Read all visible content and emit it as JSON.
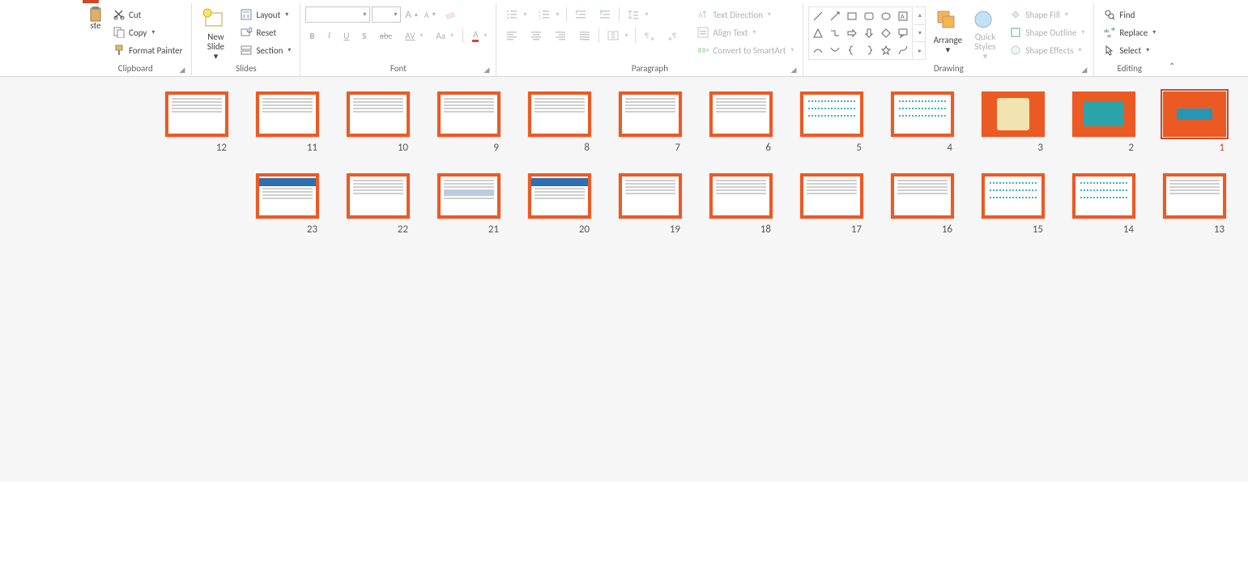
{
  "ribbon": {
    "clipboard": {
      "label": "Clipboard",
      "paste": "ste",
      "cut": "Cut",
      "copy": "Copy",
      "format_painter": "Format Painter"
    },
    "slides": {
      "label": "Slides",
      "new_slide": "New\nSlide",
      "layout": "Layout",
      "reset": "Reset",
      "section": "Section"
    },
    "font": {
      "label": "Font",
      "name_placeholder": "",
      "size_placeholder": "",
      "bold": "B",
      "italic": "I",
      "underline": "U",
      "shadow": "S",
      "strike": "abc",
      "spacing": "AV",
      "case": "Aa",
      "color": "A"
    },
    "paragraph": {
      "label": "Paragraph",
      "text_direction": "Text Direction",
      "align_text": "Align Text",
      "smartart": "Convert to SmartArt"
    },
    "drawing": {
      "label": "Drawing",
      "arrange": "Arrange",
      "quick_styles": "Quick\nStyles",
      "shape_fill": "Shape Fill",
      "shape_outline": "Shape Outline",
      "shape_effects": "Shape Effects"
    },
    "editing": {
      "label": "Editing",
      "find": "Find",
      "replace": "Replace",
      "select": "Select"
    }
  },
  "slide_sorter": {
    "selected": 1,
    "count": 23,
    "slides": [
      1,
      2,
      3,
      4,
      5,
      6,
      7,
      8,
      9,
      10,
      11,
      12,
      13,
      14,
      15,
      16,
      17,
      18,
      19,
      20,
      21,
      22,
      23
    ]
  }
}
